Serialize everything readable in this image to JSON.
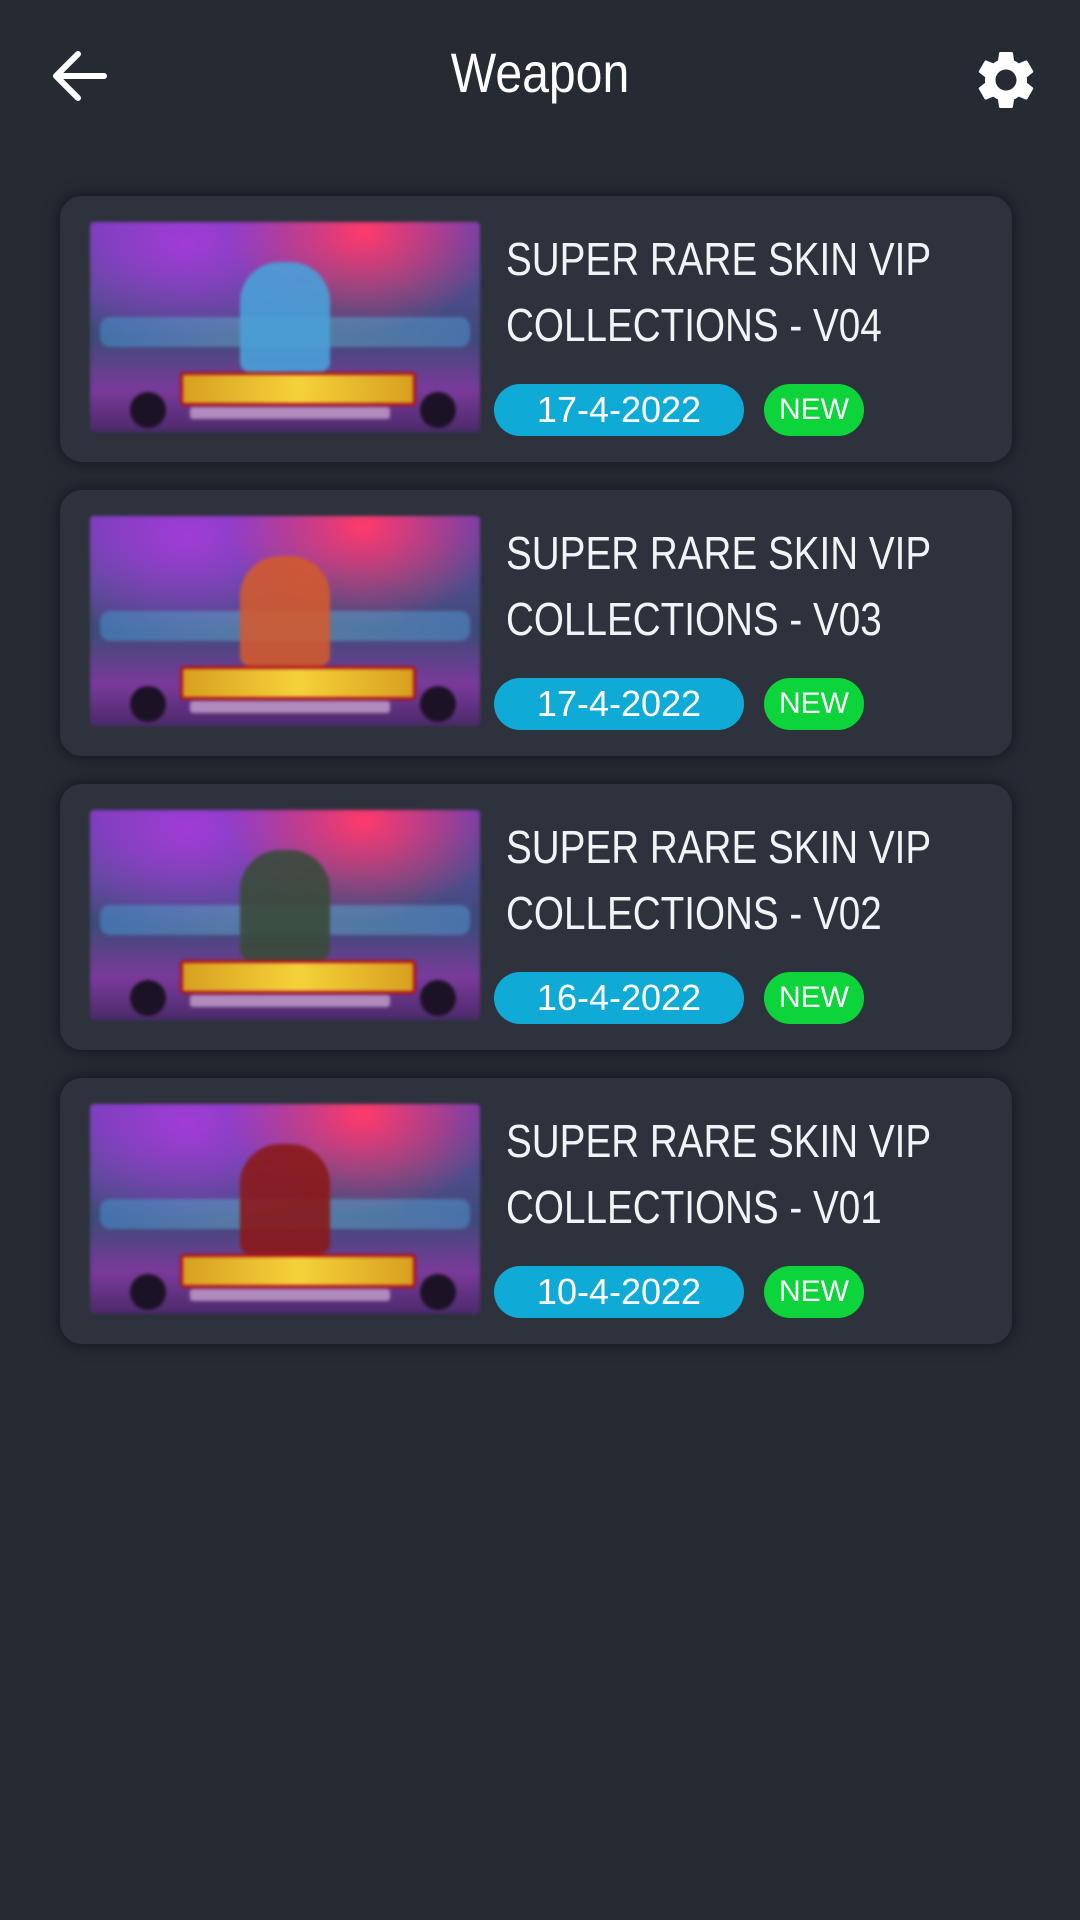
{
  "header": {
    "title": "Weapon",
    "back_icon": "arrow-left-icon",
    "settings_icon": "gear-icon"
  },
  "colors": {
    "background": "#262a33",
    "card": "#2d323c",
    "date_badge": "#10aad6",
    "new_badge": "#0ed43c"
  },
  "items": [
    {
      "title_line1": "SUPER RARE SKIN VIP",
      "title_line2": "COLLECTIONS - V04",
      "date": "17-4-2022",
      "badge": "NEW",
      "figure_color": "#4aa0d8"
    },
    {
      "title_line1": "SUPER RARE SKIN VIP",
      "title_line2": "COLLECTIONS - V03",
      "date": "17-4-2022",
      "badge": "NEW",
      "figure_color": "#d05a30"
    },
    {
      "title_line1": "SUPER RARE SKIN VIP",
      "title_line2": "COLLECTIONS - V02",
      "date": "16-4-2022",
      "badge": "NEW",
      "figure_color": "#3a4a3a"
    },
    {
      "title_line1": "SUPER RARE SKIN VIP",
      "title_line2": "COLLECTIONS - V01",
      "date": "10-4-2022",
      "badge": "NEW",
      "figure_color": "#8a1a1a"
    }
  ]
}
